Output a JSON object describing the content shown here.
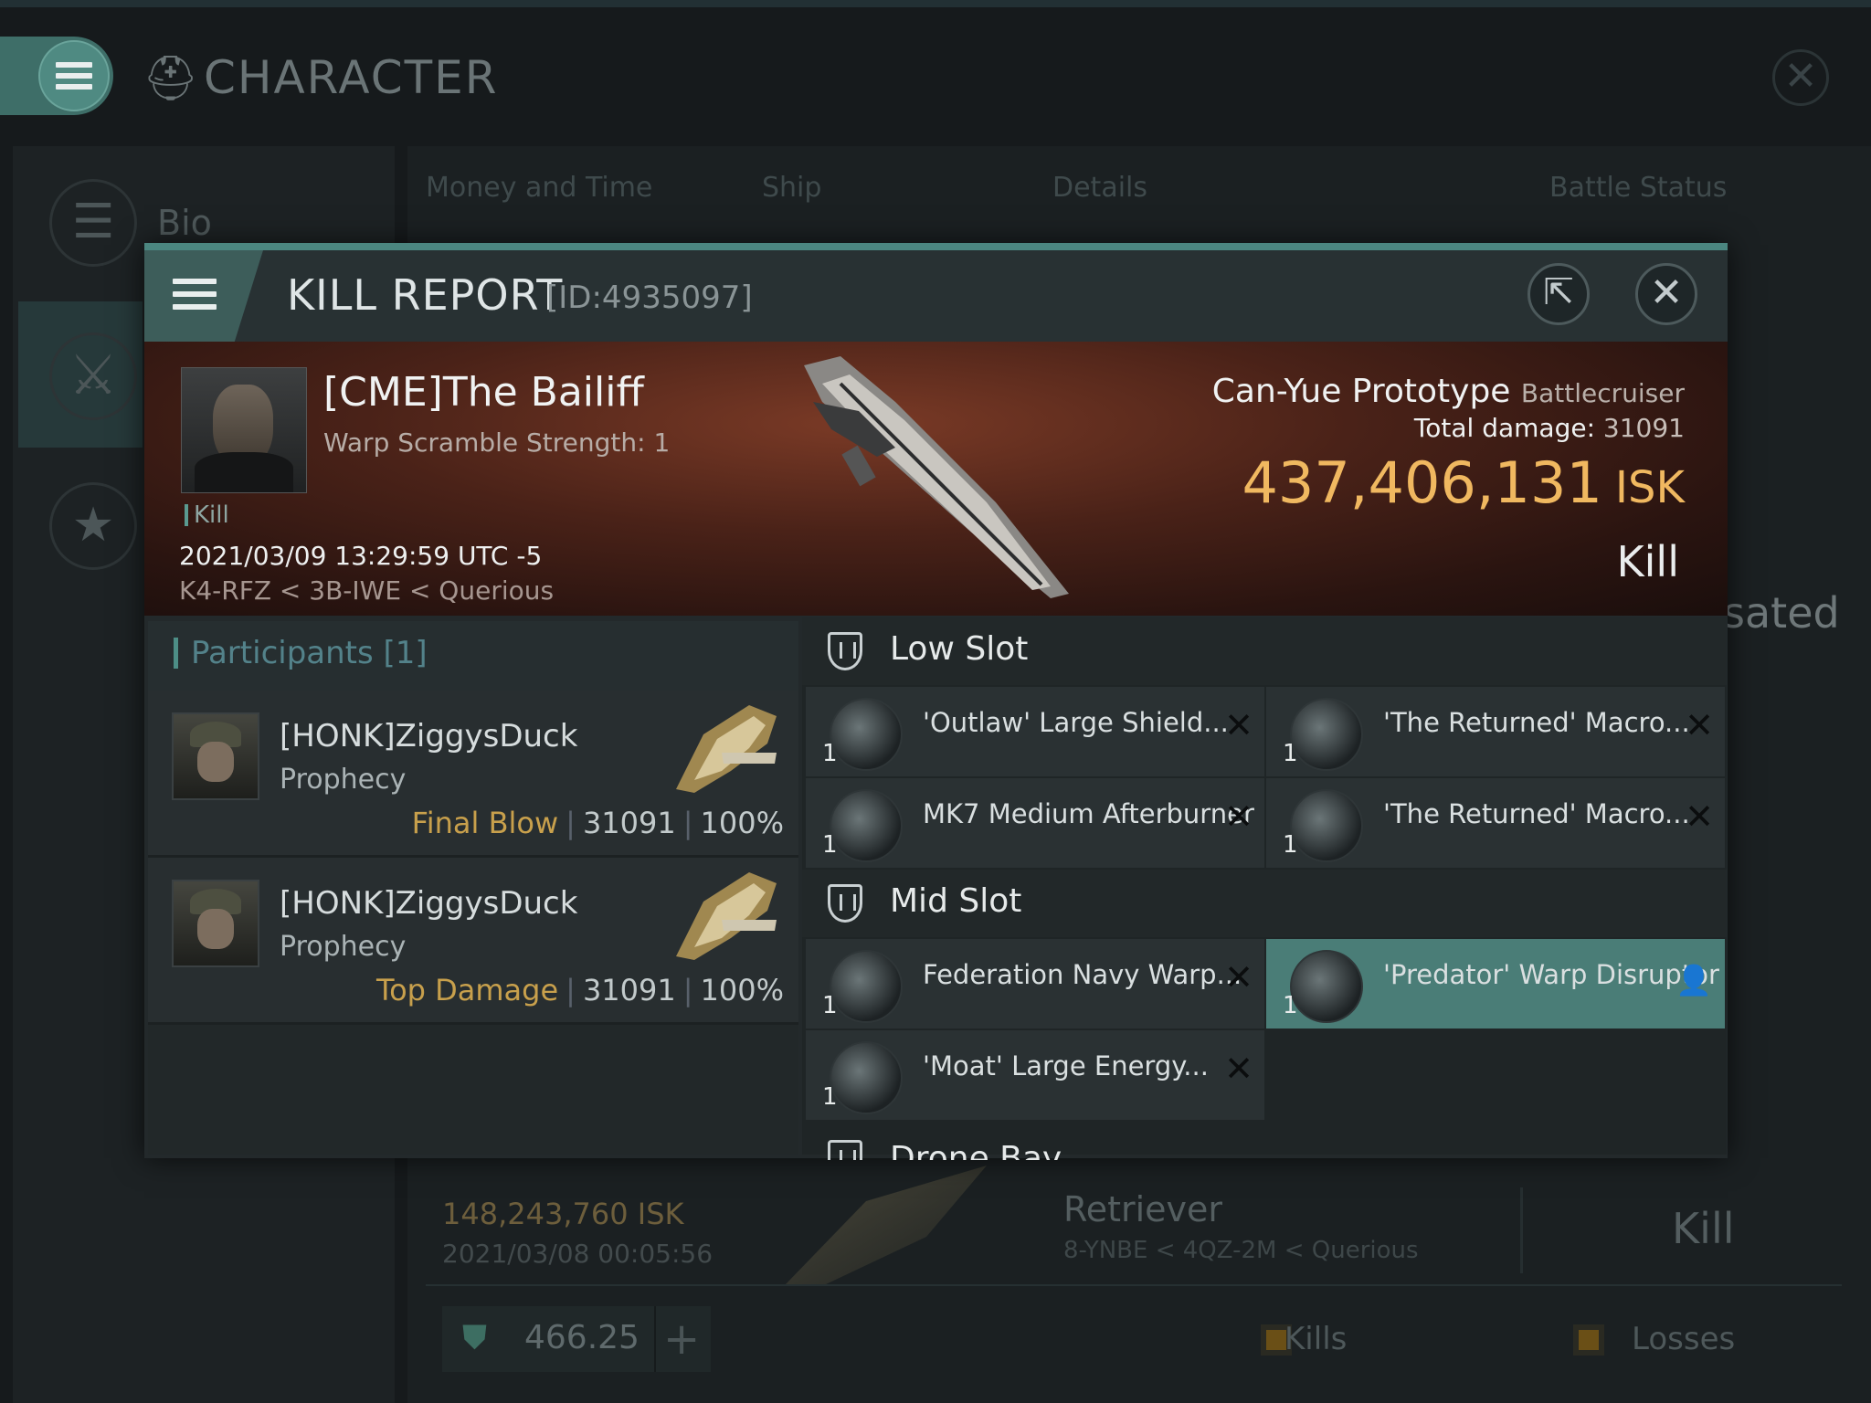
{
  "background": {
    "title": "CHARACTER",
    "sidebar_label": "Bio",
    "tabs": [
      "Money and Time",
      "Ship",
      "Details",
      "Battle Status"
    ],
    "partial_text": "sated",
    "row": {
      "isk": "148,243,760  ISK",
      "date": "2021/03/08  00:05:56",
      "ship": "Retriever",
      "location": "8-YNBE < 4QZ-2M < Querious",
      "type": "Kill"
    },
    "footer": {
      "value": "466.25",
      "kills_label": "Kills",
      "losses_label": "Losses"
    }
  },
  "kill_report": {
    "title": "KILL REPORT",
    "id": "[ID:4935097]",
    "victim": {
      "name": "[CME]The Bailiff",
      "warp_scramble": "Warp Scramble Strength: 1",
      "tag": "Kill",
      "datetime": "2021/03/09 13:29:59 UTC -5",
      "location": "K4-RFZ < 3B-IWE < Querious"
    },
    "ship": {
      "name": "Can-Yue Prototype",
      "class": "Battlecruiser",
      "total_damage_label": "Total damage:",
      "total_damage": "31091",
      "isk_value": "437,406,131",
      "isk_unit": "ISK",
      "result": "Kill"
    },
    "participants": {
      "title": "Participants",
      "count": "[1]",
      "rows": [
        {
          "name": "[HONK]ZiggysDuck",
          "ship": "Prophecy",
          "label": "Final Blow",
          "damage": "31091",
          "percent": "100%"
        },
        {
          "name": "[HONK]ZiggysDuck",
          "ship": "Prophecy",
          "label": "Top Damage",
          "damage": "31091",
          "percent": "100%"
        }
      ]
    },
    "low_slot": {
      "title": "Low Slot",
      "modules": [
        {
          "name": "'Outlaw' Large Shield...",
          "qty": "1"
        },
        {
          "name": "'The Returned' Macro...",
          "qty": "1"
        },
        {
          "name": "MK7 Medium Afterburner",
          "qty": "1"
        },
        {
          "name": "'The Returned' Macro...",
          "qty": "1"
        }
      ]
    },
    "mid_slot": {
      "title": "Mid Slot",
      "modules": [
        {
          "name": "Federation Navy Warp...",
          "qty": "1"
        },
        {
          "name": "'Predator' Warp Disruptor",
          "qty": "1"
        },
        {
          "name": "'Moat' Large Energy...",
          "qty": "1"
        }
      ]
    },
    "drone_bay": {
      "title": "Drone Bay"
    }
  },
  "colors": {
    "accent": "#4b8680",
    "isk_gold": "#f0b860",
    "final_blow": "#c8a04c",
    "selected_module": "#4a7d77"
  }
}
